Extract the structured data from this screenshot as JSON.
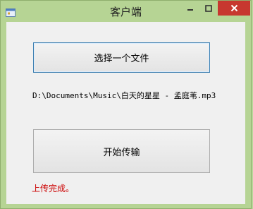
{
  "window": {
    "title": "客户端",
    "icons": {
      "app": "app-window-icon",
      "minimize": "minimize-icon",
      "maximize": "maximize-icon",
      "close": "close-icon"
    }
  },
  "main": {
    "choose_file_label": "选择一个文件",
    "file_path": "D:\\Documents\\Music\\白天的星星 - 孟庭苇.mp3",
    "start_transfer_label": "开始传输",
    "status": "上传完成。"
  },
  "colors": {
    "desktop": "#b6d494",
    "close_button": "#c7372f",
    "status_text": "#cc0000",
    "focus_border": "#3c7fb1"
  }
}
